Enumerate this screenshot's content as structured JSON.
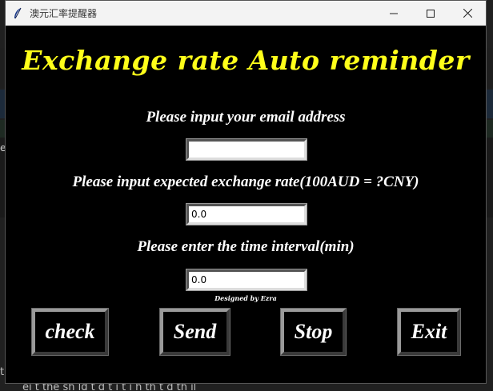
{
  "window": {
    "title": "澳元汇率提醒器",
    "controls": {
      "minimize_icon": "minimize-icon",
      "maximize_icon": "maximize-icon",
      "close_icon": "close-icon"
    }
  },
  "app": {
    "heading": "Exchange rate Auto reminder",
    "heading_color": "#ffff1a",
    "email": {
      "label": "Please input your email address",
      "value": ""
    },
    "rate": {
      "label": "Please input expected exchange rate(100AUD = ?CNY)",
      "value": "0.0"
    },
    "interval": {
      "label": "Please enter the time interval(min)",
      "value": "0.0"
    },
    "credit": "Designed by Ezra",
    "buttons": {
      "check": "check",
      "send": "Send",
      "stop": "Stop",
      "exit": "Exit"
    }
  },
  "background": {
    "edge_text": "er",
    "bottom_text": "th",
    "bottom_text2": "ei   t the sh ld t  d t i  t  i   h  th  t    d th       il"
  }
}
